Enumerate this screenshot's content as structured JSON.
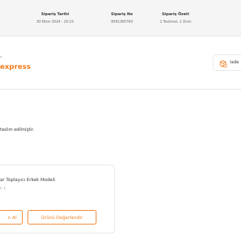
{
  "order_summary": {
    "date": {
      "label": "Sipariş Tarihi",
      "value": "30 Ekim 2024 - 20:23"
    },
    "order_no": {
      "label": "Sipariş No",
      "value": "9581365760"
    },
    "summary": {
      "label": "Sipariş Özeti",
      "value": "1 Teslimat, 1 Ürün"
    }
  },
  "seller": {
    "small_label": "sı",
    "name": "express"
  },
  "help_button": {
    "label": "Iade"
  },
  "delivery": {
    "status_text": "teslim edilmiştir."
  },
  "product": {
    "name": "ar Toplayıcı Erkek Modeli",
    "quantity": "t: 1"
  },
  "actions": {
    "buy_again": "n Al",
    "review": "Ürünü Değerlendir"
  },
  "colors": {
    "accent": "#f27a1a",
    "band": "#f5f5f5",
    "border": "#e6e6e6"
  },
  "icons": {
    "help": "return-box-icon"
  }
}
